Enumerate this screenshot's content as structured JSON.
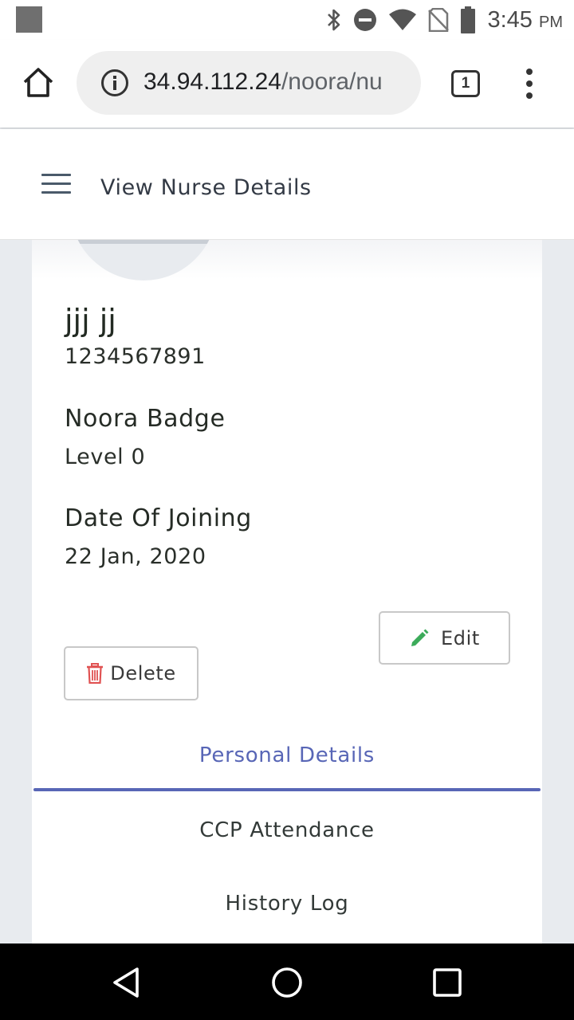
{
  "status_bar": {
    "time": "3:45",
    "ampm": "PM",
    "icons": [
      "notification-square-icon",
      "bluetooth-icon",
      "do-not-disturb-icon",
      "wifi-icon",
      "no-sim-icon",
      "battery-icon"
    ]
  },
  "browser": {
    "url_host": "34.94.112.24",
    "url_path": "/noora/nu",
    "tab_count": "1",
    "icons": [
      "home-icon",
      "info-icon",
      "more-vert-icon"
    ]
  },
  "header": {
    "title": "View Nurse Details"
  },
  "profile": {
    "name": "jjj jj",
    "phone": "1234567891",
    "badge_label": "Noora Badge",
    "badge_value": "Level 0",
    "joining_label": "Date Of Joining",
    "joining_value": "22 Jan, 2020"
  },
  "actions": {
    "edit_label": "Edit",
    "delete_label": "Delete"
  },
  "tabs": [
    {
      "label": "Personal Details",
      "active": true
    },
    {
      "label": "CCP Attendance",
      "active": false
    },
    {
      "label": "History Log",
      "active": false
    }
  ],
  "colors": {
    "accent": "#5866b6",
    "edit_icon": "#3cab5a",
    "delete_icon": "#e05252"
  }
}
